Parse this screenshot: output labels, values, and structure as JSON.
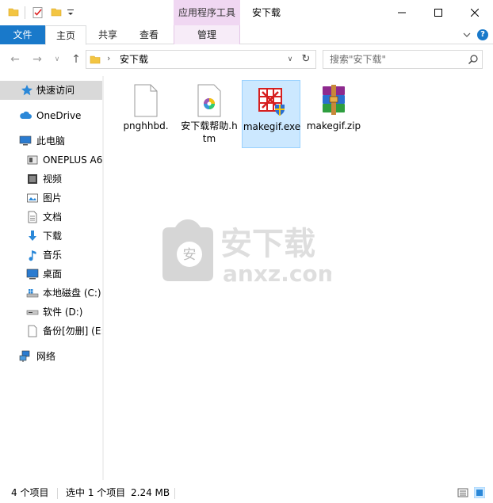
{
  "window": {
    "title": "安下载",
    "context_tab_group": "应用程序工具"
  },
  "ribbon": {
    "tabs": [
      "文件",
      "主页",
      "共享",
      "查看",
      "管理"
    ]
  },
  "address": {
    "path": "安下载",
    "search_placeholder": "搜索\"安下载\""
  },
  "nav": {
    "quick_access": "快速访问",
    "onedrive": "OneDrive",
    "this_pc": "此电脑",
    "items": [
      "ONEPLUS A6",
      "视频",
      "图片",
      "文档",
      "下载",
      "音乐",
      "桌面",
      "本地磁盘 (C:)",
      "软件 (D:)",
      "备份[勿删] (E:"
    ],
    "network": "网络"
  },
  "files": [
    {
      "name": "pnghhbd.",
      "type": "blank",
      "selected": false
    },
    {
      "name": "安下载帮助.htm",
      "type": "htm",
      "selected": false
    },
    {
      "name": "makegif.exe",
      "type": "exe",
      "selected": true
    },
    {
      "name": "makegif.zip",
      "type": "zip",
      "selected": false
    }
  ],
  "watermark": {
    "cn": "安下载",
    "en": "anxz.com",
    "badge": "安"
  },
  "status": {
    "count": "4 个项目",
    "selection": "选中 1 个项目",
    "size": "2.24 MB"
  },
  "colors": {
    "accent": "#1979ca",
    "context_tab": "#f0d7f2",
    "selection": "#cce8ff",
    "nav_selected": "#d9d9d9"
  }
}
